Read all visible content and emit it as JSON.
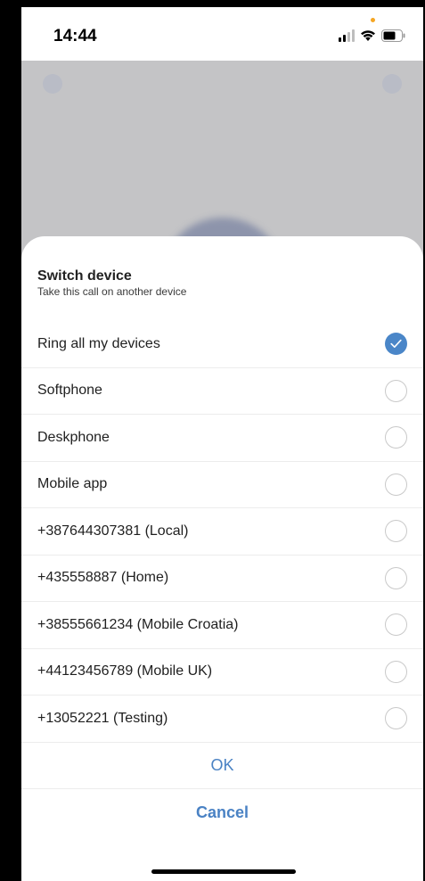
{
  "status_bar": {
    "time": "14:44",
    "signal_icon": "cellular-signal-icon",
    "wifi_icon": "wifi-icon",
    "battery_icon": "battery-icon",
    "privacy_dot_color": "#f5a623"
  },
  "sheet": {
    "title": "Switch device",
    "subtitle": "Take this call on another device",
    "options": [
      {
        "label": "Ring all my devices",
        "selected": true
      },
      {
        "label": "Softphone",
        "selected": false
      },
      {
        "label": "Deskphone",
        "selected": false
      },
      {
        "label": "Mobile app",
        "selected": false
      },
      {
        "label": "+387644307381 (Local)",
        "selected": false
      },
      {
        "label": "+435558887 (Home)",
        "selected": false
      },
      {
        "label": "+38555661234 (Mobile Croatia)",
        "selected": false
      },
      {
        "label": "+44123456789 (Mobile UK)",
        "selected": false
      },
      {
        "label": "+13052221 (Testing)",
        "selected": false
      }
    ],
    "ok_label": "OK",
    "cancel_label": "Cancel"
  },
  "colors": {
    "accent": "#4a86c8",
    "action_text": "#4a82c4",
    "backdrop": "#c4c4c6"
  }
}
